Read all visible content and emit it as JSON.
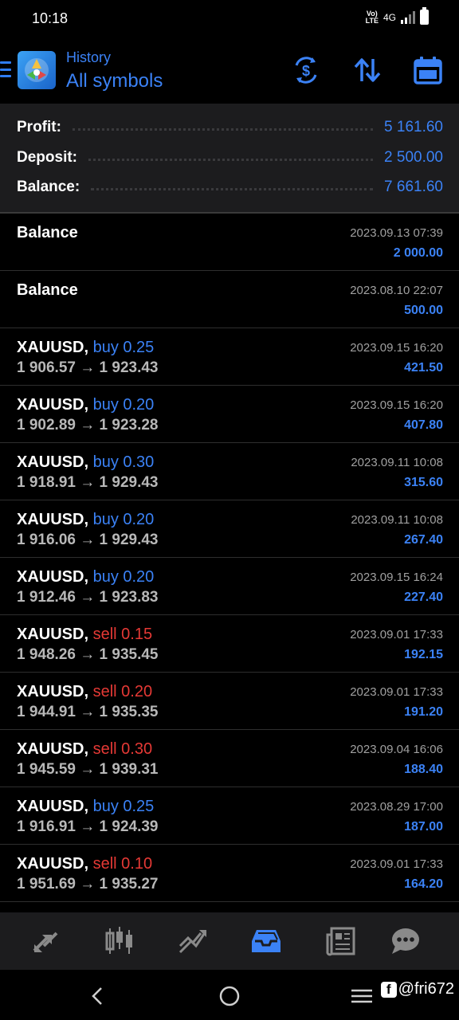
{
  "status_bar": {
    "time": "10:18",
    "volte": "Vo) LTE",
    "network": "4G"
  },
  "header": {
    "subtitle": "History",
    "title": "All symbols"
  },
  "summary": {
    "profit_label": "Profit:",
    "profit_value": "5 161.60",
    "deposit_label": "Deposit:",
    "deposit_value": "2 500.00",
    "balance_label": "Balance:",
    "balance_value": "7 661.60"
  },
  "balance_entries": [
    {
      "title": "Balance",
      "date": "2023.09.13 07:39",
      "amount": "2 000.00"
    },
    {
      "title": "Balance",
      "date": "2023.08.10 22:07",
      "amount": "500.00"
    }
  ],
  "deals": [
    {
      "symbol": "XAUUSD,",
      "type": "buy 0.25",
      "side": "buy",
      "open": "1 906.57",
      "close": "1 923.43",
      "date": "2023.09.15 16:20",
      "profit": "421.50"
    },
    {
      "symbol": "XAUUSD,",
      "type": "buy 0.20",
      "side": "buy",
      "open": "1 902.89",
      "close": "1 923.28",
      "date": "2023.09.15 16:20",
      "profit": "407.80"
    },
    {
      "symbol": "XAUUSD,",
      "type": "buy 0.30",
      "side": "buy",
      "open": "1 918.91",
      "close": "1 929.43",
      "date": "2023.09.11 10:08",
      "profit": "315.60"
    },
    {
      "symbol": "XAUUSD,",
      "type": "buy 0.20",
      "side": "buy",
      "open": "1 916.06",
      "close": "1 929.43",
      "date": "2023.09.11 10:08",
      "profit": "267.40"
    },
    {
      "symbol": "XAUUSD,",
      "type": "buy 0.20",
      "side": "buy",
      "open": "1 912.46",
      "close": "1 923.83",
      "date": "2023.09.15 16:24",
      "profit": "227.40"
    },
    {
      "symbol": "XAUUSD,",
      "type": "sell 0.15",
      "side": "sell",
      "open": "1 948.26",
      "close": "1 935.45",
      "date": "2023.09.01 17:33",
      "profit": "192.15"
    },
    {
      "symbol": "XAUUSD,",
      "type": "sell 0.20",
      "side": "sell",
      "open": "1 944.91",
      "close": "1 935.35",
      "date": "2023.09.01 17:33",
      "profit": "191.20"
    },
    {
      "symbol": "XAUUSD,",
      "type": "sell 0.30",
      "side": "sell",
      "open": "1 945.59",
      "close": "1 939.31",
      "date": "2023.09.04 16:06",
      "profit": "188.40"
    },
    {
      "symbol": "XAUUSD,",
      "type": "buy 0.25",
      "side": "buy",
      "open": "1 916.91",
      "close": "1 924.39",
      "date": "2023.08.29 17:00",
      "profit": "187.00"
    },
    {
      "symbol": "XAUUSD,",
      "type": "sell 0.10",
      "side": "sell",
      "open": "1 951.69",
      "close": "1 935.27",
      "date": "2023.09.01 17:33",
      "profit": "164.20"
    }
  ],
  "arrow": "→",
  "tabs": [
    {
      "icon": "quotes-icon",
      "active": false
    },
    {
      "icon": "chart-icon",
      "active": false
    },
    {
      "icon": "trade-icon",
      "active": false
    },
    {
      "icon": "history-icon",
      "active": true
    },
    {
      "icon": "news-icon",
      "active": false
    },
    {
      "icon": "chat-icon",
      "active": false
    }
  ],
  "watermark": {
    "icon": "f",
    "text": "@fri672"
  },
  "colors": {
    "accent": "#3b82f6",
    "sell": "#e53935",
    "background": "#000000",
    "panel": "#1c1c1e"
  }
}
